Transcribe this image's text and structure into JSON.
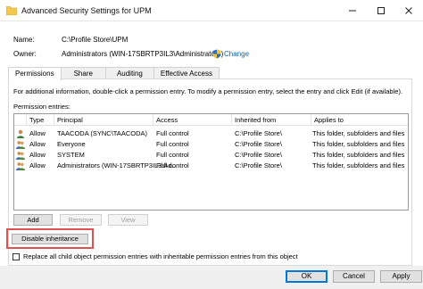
{
  "window": {
    "title": "Advanced Security Settings for UPM"
  },
  "fields": {
    "name_label": "Name:",
    "name_value": "C:\\Profile Store\\UPM",
    "owner_label": "Owner:",
    "owner_value": "Administrators (WIN-17SBRTP3IL3\\Administrators)",
    "change_link": "Change"
  },
  "tabs": [
    {
      "label": "Permissions",
      "active": true
    },
    {
      "label": "Share",
      "active": false
    },
    {
      "label": "Auditing",
      "active": false
    },
    {
      "label": "Effective Access",
      "active": false
    }
  ],
  "instructions": "For additional information, double-click a permission entry. To modify a permission entry, select the entry and click Edit (if available).",
  "entries_label": "Permission entries:",
  "table": {
    "columns": [
      "Type",
      "Principal",
      "Access",
      "Inherited from",
      "Applies to"
    ],
    "rows": [
      {
        "type": "Allow",
        "principal": "TAACODA (SYNC\\TAACODA)",
        "access": "Full control",
        "inherited": "C:\\Profile Store\\",
        "applies": "This folder, subfolders and files",
        "icon": "single-user-icon"
      },
      {
        "type": "Allow",
        "principal": "Everyone",
        "access": "Full control",
        "inherited": "C:\\Profile Store\\",
        "applies": "This folder, subfolders and files",
        "icon": "user-group-icon"
      },
      {
        "type": "Allow",
        "principal": "SYSTEM",
        "access": "Full control",
        "inherited": "C:\\Profile Store\\",
        "applies": "This folder, subfolders and files",
        "icon": "user-group-icon"
      },
      {
        "type": "Allow",
        "principal": "Administrators (WIN-17SBRTP3IL3\\Ad...",
        "access": "Full control",
        "inherited": "C:\\Profile Store\\",
        "applies": "This folder, subfolders and files",
        "icon": "user-group-icon"
      }
    ]
  },
  "buttons": {
    "add": "Add",
    "remove": "Remove",
    "view": "View",
    "disable_inheritance": "Disable inheritance"
  },
  "replace_checkbox": {
    "label": "Replace all child object permission entries with inheritable permission entries from this object",
    "checked": false
  },
  "footer": {
    "ok": "OK",
    "cancel": "Cancel",
    "apply": "Apply"
  },
  "colors": {
    "link": "#0a5fb4",
    "highlight": "#e05252",
    "focus": "#0078d7"
  }
}
